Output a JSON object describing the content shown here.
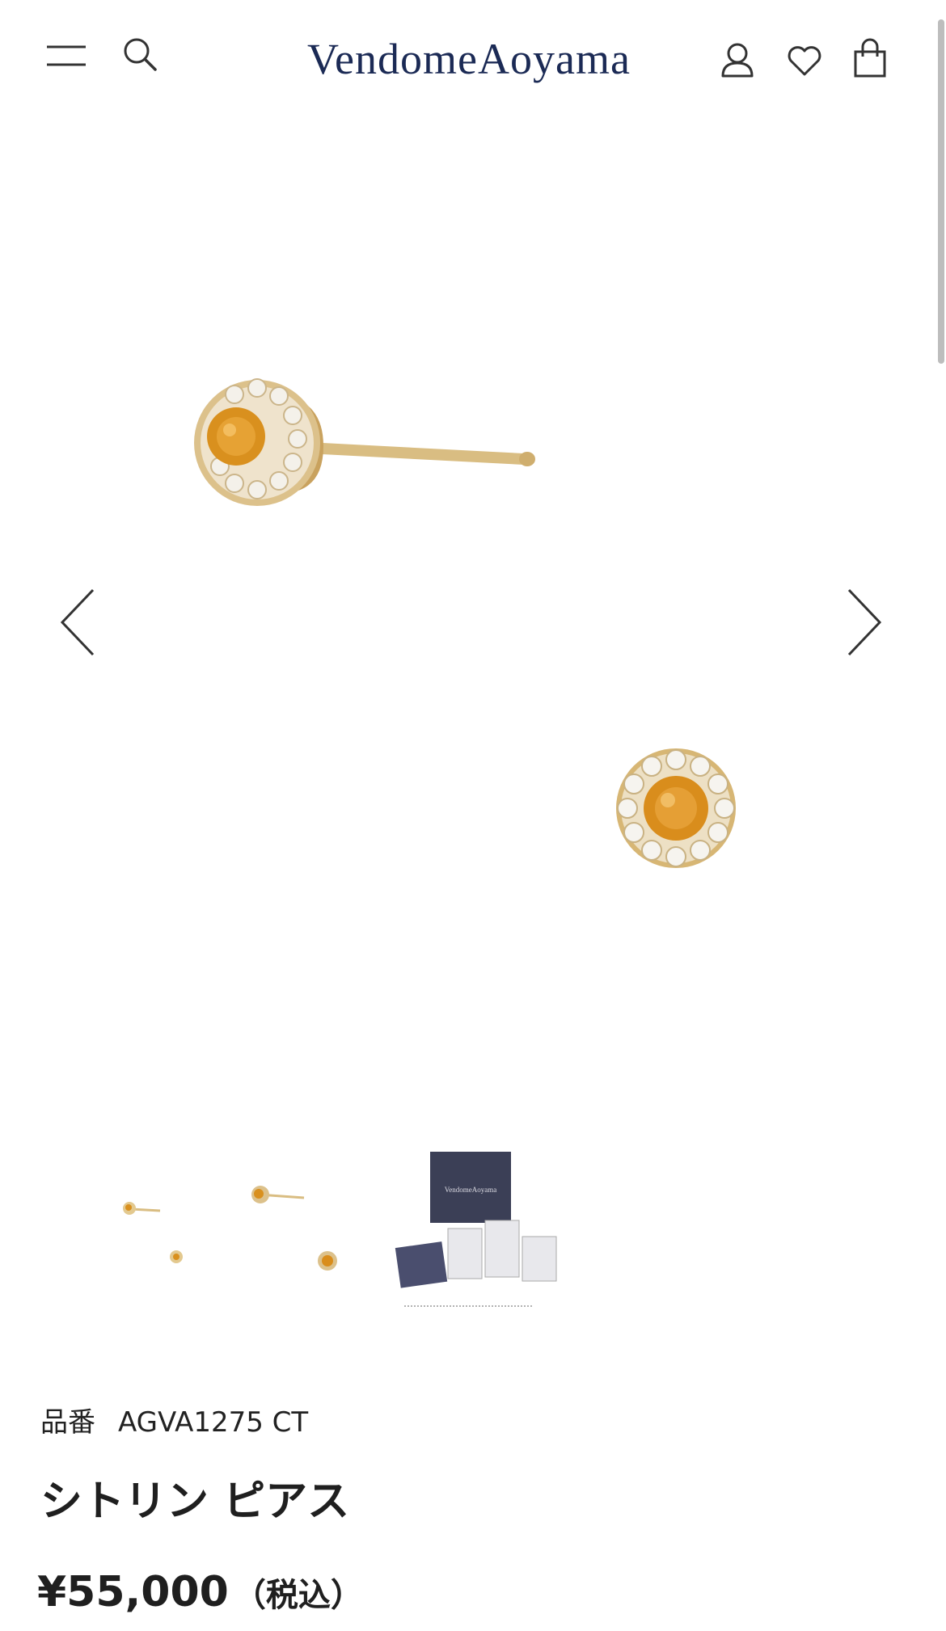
{
  "header": {
    "logo": "VendomeAoyama",
    "menu_icon": "hamburger-menu-icon",
    "search_icon": "search-icon",
    "account_icon": "user-icon",
    "wishlist_icon": "heart-icon",
    "cart_icon": "shopping-bag-icon"
  },
  "gallery": {
    "prev_icon": "chevron-left-icon",
    "next_icon": "chevron-right-icon",
    "thumbnails": [
      {
        "name": "thumbnail-earring-small"
      },
      {
        "name": "thumbnail-earring-detail"
      },
      {
        "name": "thumbnail-packaging",
        "logo_text": "VendomeAoyama"
      }
    ]
  },
  "product": {
    "code_label": "品番",
    "code": "AGVA1275 CT",
    "name": "シトリン ピアス",
    "price": "¥55,000",
    "tax_note": "（税込）"
  },
  "colors": {
    "brand": "#1b2a55",
    "gold": "#d4b06a",
    "citrine": "#d9901e"
  }
}
